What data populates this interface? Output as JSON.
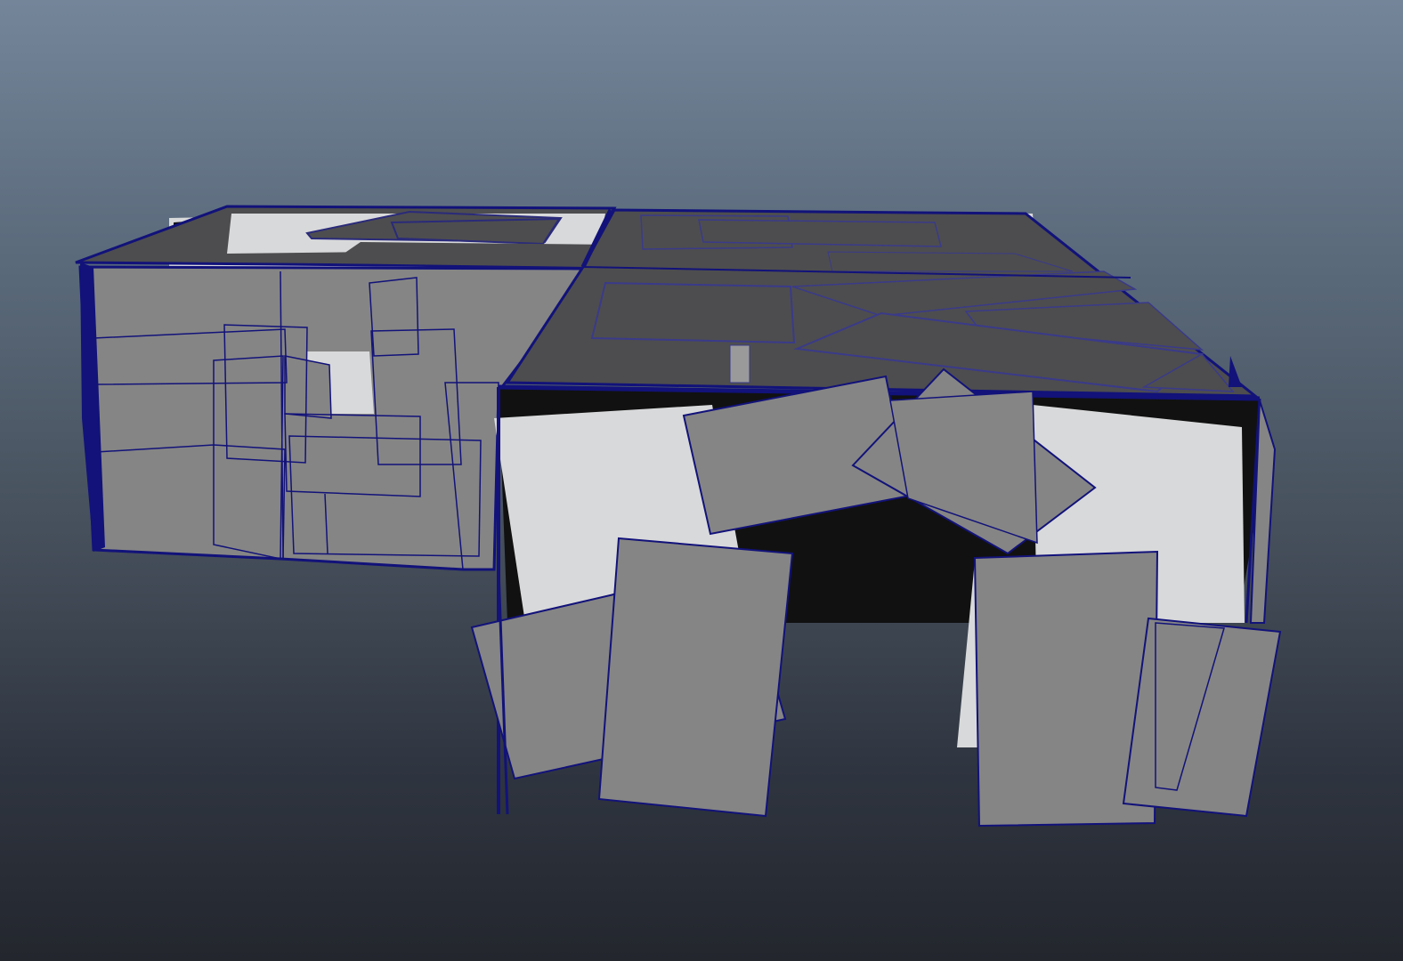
{
  "viewport": {
    "background_top": "#74859a",
    "background_bottom": "#23262d",
    "wire_color": "#12127a",
    "panel_dark": "#4d4d4f",
    "panel_mid": "#858585",
    "panel_light": "#d8d9da",
    "shadow_color": "#101010"
  }
}
